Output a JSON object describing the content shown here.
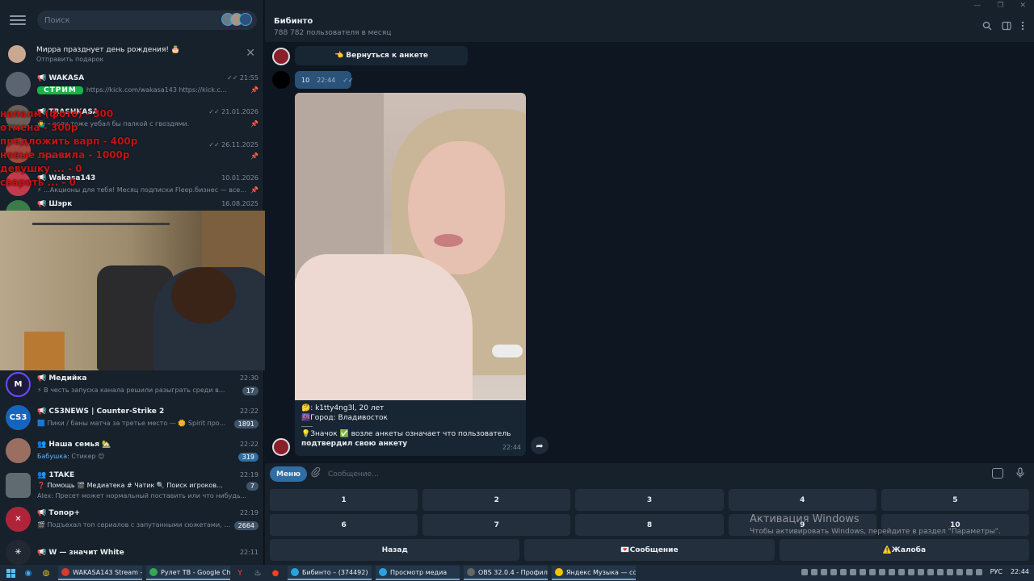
{
  "search": {
    "placeholder": "Поиск"
  },
  "birthday": {
    "title": "Мирра празднует день рождения! 🎂",
    "subtitle": "Отправить подарок",
    "close": "✕"
  },
  "chats": [
    {
      "name": "📢 WAKASA",
      "time": "✓✓ 21:55",
      "preview_tag": "СТРИМ",
      "preview": "https://kick.com/wakasa143  https://kick.c...",
      "pin": "📌",
      "color": "#5b6470"
    },
    {
      "name": "📢 TRASHKASA",
      "time": "✓✓ 21.01.2026",
      "preview": "🤷‍♂️ – если тоже уебал бы палкой с гвоздями.",
      "pin": "📌",
      "color": "#6b5f58"
    },
    {
      "name": "",
      "time": "✓✓ 26.11.2025",
      "preview": "...лайте?",
      "pin": "📌",
      "color": "#a4473f"
    },
    {
      "name": "📢 Wakasa143",
      "time": "10.01.2026",
      "preview": "⚡ ...Акционы для тебя! Месяц подписки Fleep.бизнес — все...",
      "pin": "📌",
      "color": "#c23a4c"
    },
    {
      "name": "📢 Шэрк",
      "time": "16.08.2025",
      "preview": "",
      "pin": "",
      "color": "#3a7c4a"
    }
  ],
  "chats_lower": [
    {
      "name": "📢 Медийка",
      "time": "22:30",
      "preview": "⚡ В честь запуска канала решили разыграть среди в...",
      "badge": "17",
      "color": "#1e1b3a",
      "initials": "M"
    },
    {
      "name": "📢 CS3NEWS | Counter-Strike 2",
      "time": "22:22",
      "preview": "🟦 Пики / баны матча за третье место — 🌼 Spirit про...",
      "badge": "1891",
      "color": "#1565c0",
      "initials": "CS3"
    },
    {
      "name": "👥 Наша семья 🏡",
      "time": "22:22",
      "sender": "Бабушка:",
      "preview": "Стикер 😊",
      "badge": "319",
      "badge_blue": true,
      "color": "#9a6f62",
      "initials": ""
    },
    {
      "name": "👥 1TAKE",
      "time": "22:19",
      "preview": "❓ Помощь  🎬 Медиатека  # Чатик  🔍 Поиск игроков...",
      "preview2": "Alex: Пресет может нормальный поставить или что нибудь...",
      "badge": "7",
      "color": "#5f6b70",
      "initials": ""
    },
    {
      "name": "📢 Топор+",
      "time": "22:19",
      "preview": "🎬 Подъехал топ сериалов с запутанными сюжетами, кот...",
      "badge": "2664",
      "color": "#b0243a",
      "initials": "✕"
    },
    {
      "name": "📢 W — значит White",
      "time": "22:11",
      "preview": "",
      "badge": "",
      "color": "#222831",
      "initials": "✳"
    }
  ],
  "overlay_lines": [
    "напалм (фото) - 300",
    "отмена - 300р",
    "предложить варп - 400р",
    "новые правила - 1000р",
    "девушку ... - 0",
    "сварить ... - 0"
  ],
  "header": {
    "title": "Бибинто",
    "subtitle": "788 782 пользователя в месяц",
    "win_min": "—",
    "win_max": "❐",
    "win_close": "✕"
  },
  "messages": {
    "return_btn": "👈 Вернуться к анкете",
    "num_msg": "10",
    "num_time": "22:44",
    "num_check": "✓✓",
    "caption_line1": "🤔: k1tty4ng3l, 20 лет",
    "caption_line2": "🌆Город: Владивосток",
    "caption_line3": "💡Значок ✅ возле анкеты означает что пользователь",
    "caption_line4": "подтвердил свою анкету",
    "caption_time": "22:44"
  },
  "composer": {
    "menu": "Меню",
    "placeholder": "Сообщение..."
  },
  "keyboard": {
    "row1": [
      "1",
      "2",
      "3",
      "4",
      "5"
    ],
    "row2": [
      "6",
      "7",
      "8",
      "9",
      "10"
    ],
    "row3": [
      "Назад",
      "💌Сообщение",
      "⚠️Жалоба"
    ]
  },
  "watermark": {
    "line1": "Активация Windows",
    "line2": "Чтобы активировать Windows, перейдите в раздел \"Параметры\"."
  },
  "taskbar": {
    "apps": [
      {
        "label": "WAKASA143 Stream -...",
        "color": "#d83b2c"
      },
      {
        "label": "Рулет ТВ - Google Ch...",
        "color": "#34a853"
      },
      {
        "label": "Бибинто – (374492)",
        "color": "#2aa3df"
      },
      {
        "label": "Просмотр медиа",
        "color": "#2aa3df"
      },
      {
        "label": "OBS 32.0.4 - Профил...",
        "color": "#444"
      },
      {
        "label": "Яндекс Музыка — со...",
        "color": "#f5c400"
      }
    ],
    "lang": "РУС",
    "clock": "22:44"
  }
}
